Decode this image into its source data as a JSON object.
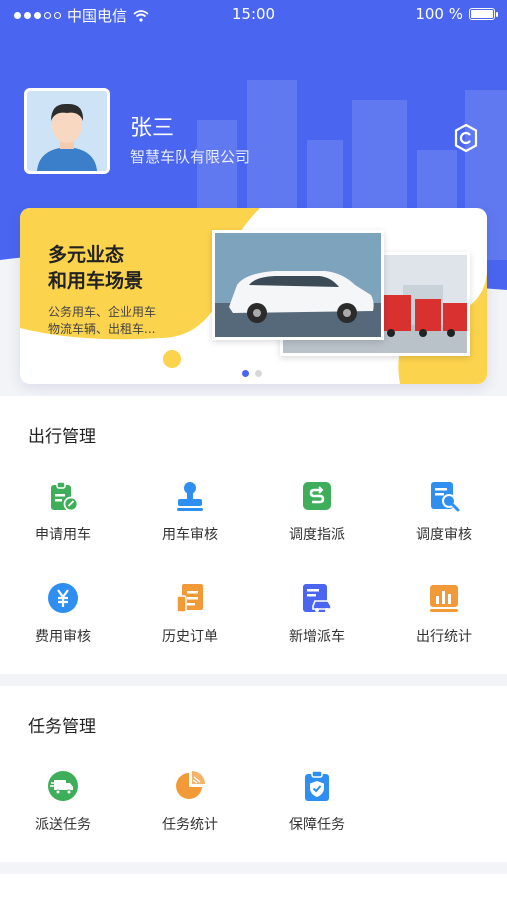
{
  "status_bar": {
    "carrier": "中国电信",
    "time": "15:00",
    "battery": "100 %"
  },
  "profile": {
    "name": "张三",
    "company": "智慧车队有限公司"
  },
  "icons": {
    "settings": "settings-icon",
    "avatar": "user-avatar"
  },
  "banner": {
    "title_line1": "多元业态",
    "title_line2": "和用车场景",
    "sub_line1": "公务用车、企业用车",
    "sub_line2": "物流车辆、出租车..."
  },
  "travel": {
    "title": "出行管理",
    "items": [
      {
        "label": "申请用车",
        "icon": "apply-car-icon",
        "color": "#3fae5a"
      },
      {
        "label": "用车审核",
        "icon": "stamp-icon",
        "color": "#2f8ff0"
      },
      {
        "label": "调度指派",
        "icon": "dispatch-icon",
        "color": "#3fae5a"
      },
      {
        "label": "调度审核",
        "icon": "dispatch-review-icon",
        "color": "#2f8ff0"
      },
      {
        "label": "费用审核",
        "icon": "yuan-icon",
        "color": "#2f8ff0"
      },
      {
        "label": "历史订单",
        "icon": "history-order-icon",
        "color": "#f29a38"
      },
      {
        "label": "新增派车",
        "icon": "add-vehicle-icon",
        "color": "#4a66f0"
      },
      {
        "label": "出行统计",
        "icon": "bar-chart-icon",
        "color": "#f29a38"
      }
    ]
  },
  "tasks": {
    "title": "任务管理",
    "items": [
      {
        "label": "派送任务",
        "icon": "delivery-truck-icon",
        "color": "#3fae5a"
      },
      {
        "label": "任务统计",
        "icon": "pie-chart-icon",
        "color": "#f29a38"
      },
      {
        "label": "保障任务",
        "icon": "shield-clipboard-icon",
        "color": "#2f8ff0"
      }
    ]
  }
}
